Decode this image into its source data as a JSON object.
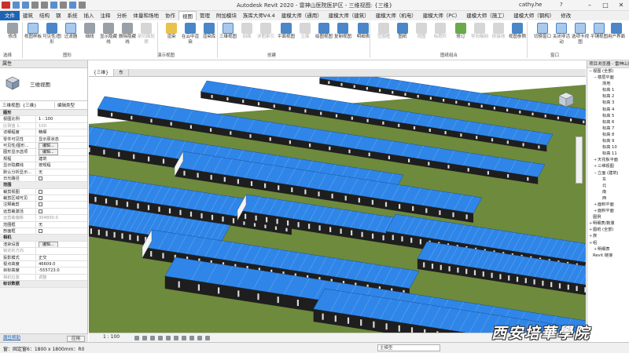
{
  "app": {
    "title": "Autodesk Revit 2020 - 雷神山医院医护区 - 三维视图: {三维}",
    "user": "cathy.he",
    "help_symbol": "?"
  },
  "menu_tabs": [
    "文件",
    "建筑",
    "结构",
    "钢",
    "系统",
    "插入",
    "注释",
    "分析",
    "体量和场地",
    "协作",
    "视图",
    "管理",
    "附加模块",
    "族库大师V4.4",
    "建模大师（通用）",
    "建模大师（建筑）",
    "建模大师（机电）",
    "建模大师（PC）",
    "建模大师（施工）",
    "建模大师（钢构）",
    "修改"
  ],
  "active_tab": "视图",
  "ribbon": {
    "buttons": [
      {
        "label": "修改",
        "enabled": true
      },
      {
        "label": "视图样板",
        "enabled": true
      },
      {
        "label": "可见性/图形",
        "enabled": true
      },
      {
        "label": "过滤器",
        "enabled": true
      },
      {
        "label": "细线",
        "enabled": true
      },
      {
        "label": "显示隐藏线",
        "enabled": true
      },
      {
        "label": "删除隐藏线",
        "enabled": true
      },
      {
        "label": "剖切面轮廓",
        "enabled": false
      },
      {
        "label": "渲染",
        "enabled": true
      },
      {
        "label": "在云中渲染",
        "enabled": true
      },
      {
        "label": "渲染库",
        "enabled": true
      },
      {
        "label": "三维视图",
        "enabled": true
      },
      {
        "label": "剖面",
        "enabled": false
      },
      {
        "label": "详图索引",
        "enabled": false
      },
      {
        "label": "平面视图",
        "enabled": true
      },
      {
        "label": "立面",
        "enabled": false
      },
      {
        "label": "绘图视图",
        "enabled": true
      },
      {
        "label": "复制视图",
        "enabled": true
      },
      {
        "label": "明细表",
        "enabled": true
      },
      {
        "label": "范围框",
        "enabled": false
      },
      {
        "label": "图纸",
        "enabled": true
      },
      {
        "label": "视图",
        "enabled": false
      },
      {
        "label": "标题栏",
        "enabled": false
      },
      {
        "label": "修订",
        "enabled": true
      },
      {
        "label": "导向轴网",
        "enabled": false
      },
      {
        "label": "拼接线",
        "enabled": false
      },
      {
        "label": "视图参照",
        "enabled": true
      },
      {
        "label": "切换窗口",
        "enabled": true
      },
      {
        "label": "关闭非活动",
        "enabled": true
      },
      {
        "label": "选项卡视图",
        "enabled": true
      },
      {
        "label": "平铺视图",
        "enabled": true
      },
      {
        "label": "用户界面",
        "enabled": true
      }
    ],
    "groups": [
      "选择",
      "图形",
      "演示视图",
      "创建",
      "图纸组合",
      "窗口"
    ]
  },
  "properties": {
    "header": "属性",
    "type_name": "三维视图",
    "selector": "三维视图: {三维}",
    "edit_type": "编辑类型",
    "rows": [
      {
        "k": "图形",
        "v": "",
        "kind": "section"
      },
      {
        "k": "视图比例",
        "v": "1 : 100"
      },
      {
        "k": "比例值 1:",
        "v": "100",
        "kind": "grey"
      },
      {
        "k": "详细程度",
        "v": "精细"
      },
      {
        "k": "零件可见性",
        "v": "显示原状态"
      },
      {
        "k": "可见性/图形...",
        "v": "编辑...",
        "kind": "button"
      },
      {
        "k": "图形显示选项",
        "v": "编辑...",
        "kind": "button"
      },
      {
        "k": "规程",
        "v": "建筑"
      },
      {
        "k": "显示隐藏线",
        "v": "按规程"
      },
      {
        "k": "默认分析显示...",
        "v": "无"
      },
      {
        "k": "日光路径",
        "v": "",
        "kind": "check"
      },
      {
        "k": "范围",
        "v": "",
        "kind": "section"
      },
      {
        "k": "裁剪视图",
        "v": "",
        "kind": "check"
      },
      {
        "k": "裁剪区域可见",
        "v": "",
        "kind": "check"
      },
      {
        "k": "注释裁剪",
        "v": "",
        "kind": "check"
      },
      {
        "k": "远剪裁激活",
        "v": "",
        "kind": "check"
      },
      {
        "k": "远剪裁偏移",
        "v": "304800.0",
        "kind": "grey"
      },
      {
        "k": "范围框",
        "v": "无"
      },
      {
        "k": "剖面框",
        "v": "",
        "kind": "check"
      },
      {
        "k": "相机",
        "v": "",
        "kind": "section"
      },
      {
        "k": "渲染设置",
        "v": "编辑...",
        "kind": "button"
      },
      {
        "k": "锁定的方向",
        "v": "",
        "kind": "grey"
      },
      {
        "k": "投影模式",
        "v": "正交"
      },
      {
        "k": "视点高度",
        "v": "46609.0"
      },
      {
        "k": "目标高度",
        "v": "-555723.0"
      },
      {
        "k": "相机位置",
        "v": "调整",
        "kind": "grey"
      },
      {
        "k": "标识数据",
        "v": "",
        "kind": "section"
      }
    ],
    "help_link": "属性帮助",
    "apply_label": "应用"
  },
  "view_tabs": [
    {
      "label": "{三维}",
      "active": true
    },
    {
      "label": "东",
      "active": false
    }
  ],
  "view_control": {
    "scale": "1 : 100"
  },
  "project_browser": {
    "header": "项目浏览器 - 雷神山医院医护区",
    "nodes": [
      {
        "t": "视图 (全部)",
        "l": 0,
        "g": "−"
      },
      {
        "t": "楼层平面",
        "l": 1,
        "g": "−"
      },
      {
        "t": "场地",
        "l": 2,
        "g": ""
      },
      {
        "t": "标高 1",
        "l": 2,
        "g": ""
      },
      {
        "t": "标高 2",
        "l": 2,
        "g": ""
      },
      {
        "t": "标高 3",
        "l": 2,
        "g": ""
      },
      {
        "t": "标高 4",
        "l": 2,
        "g": ""
      },
      {
        "t": "标高 5",
        "l": 2,
        "g": ""
      },
      {
        "t": "标高 6",
        "l": 2,
        "g": ""
      },
      {
        "t": "标高 7",
        "l": 2,
        "g": ""
      },
      {
        "t": "标高 8",
        "l": 2,
        "g": ""
      },
      {
        "t": "标高 9",
        "l": 2,
        "g": ""
      },
      {
        "t": "标高 10",
        "l": 2,
        "g": ""
      },
      {
        "t": "标高 11",
        "l": 2,
        "g": ""
      },
      {
        "t": "天花板平面",
        "l": 1,
        "g": "+"
      },
      {
        "t": "三维视图",
        "l": 1,
        "g": "+"
      },
      {
        "t": "立面 (建筑)",
        "l": 1,
        "g": "−"
      },
      {
        "t": "东",
        "l": 2,
        "g": ""
      },
      {
        "t": "北",
        "l": 2,
        "g": ""
      },
      {
        "t": "南",
        "l": 2,
        "g": ""
      },
      {
        "t": "西",
        "l": 2,
        "g": ""
      },
      {
        "t": "面积平面",
        "l": 1,
        "g": "+"
      },
      {
        "t": "面积平面",
        "l": 1,
        "g": "+"
      },
      {
        "t": "图例",
        "l": 0,
        "g": ""
      },
      {
        "t": "明细表/数量",
        "l": 0,
        "g": "+"
      },
      {
        "t": "图纸 (全部)",
        "l": 0,
        "g": "+"
      },
      {
        "t": "族",
        "l": 0,
        "g": "+"
      },
      {
        "t": "组",
        "l": 0,
        "g": "+"
      },
      {
        "t": "明细表",
        "l": 1,
        "g": "+"
      },
      {
        "t": "Revit 链接",
        "l": 0,
        "g": ""
      }
    ]
  },
  "status": {
    "text": "窗：固定窗6：1800 x 1800mm：R0",
    "workset_dropdown": "主模型"
  },
  "watermark": "西安培華學院",
  "colors": {
    "roof_blue": "#2f86e8",
    "ground_green": "#6e8a3c",
    "wall_dark": "#1e1e1e",
    "file_tab": "#1e64b4"
  }
}
